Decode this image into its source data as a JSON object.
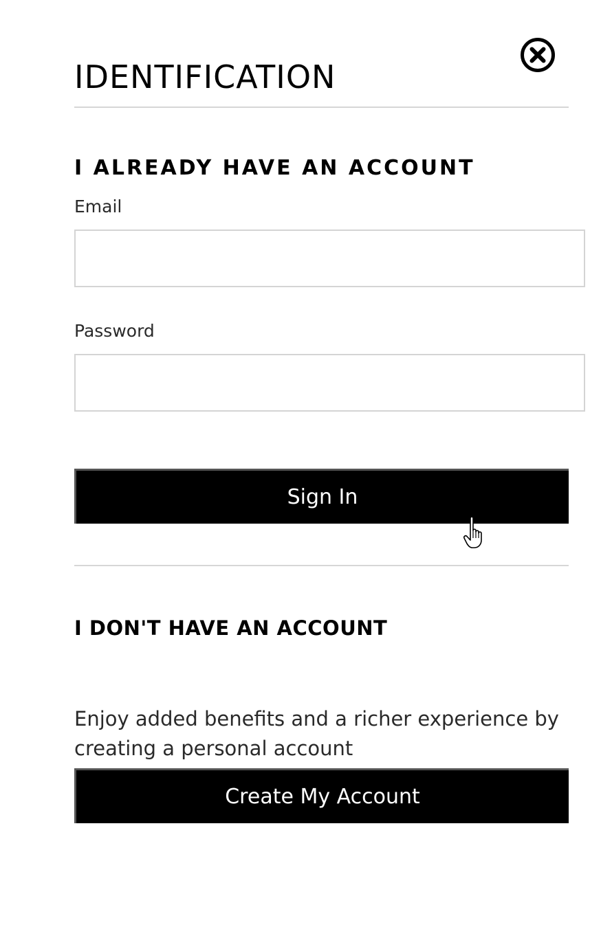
{
  "header": {
    "title": "IDENTIFICATION",
    "close_icon": "close-circle-x-icon"
  },
  "existing_account": {
    "heading": "I ALREADY HAVE AN ACCOUNT",
    "email": {
      "label": "Email",
      "value": "",
      "placeholder": ""
    },
    "password": {
      "label": "Password",
      "value": "",
      "placeholder": ""
    },
    "sign_in_label": "Sign In"
  },
  "new_account": {
    "heading": "I DON'T HAVE AN ACCOUNT",
    "description": "Enjoy added benefits and a richer experience by creating a personal account",
    "create_label": "Create My Account"
  },
  "colors": {
    "button_background": "#000000",
    "button_text": "#ffffff",
    "divider": "#d6d6d6",
    "field_border": "#d4d4d4"
  },
  "cursor_icon": "hand-pointer-icon"
}
